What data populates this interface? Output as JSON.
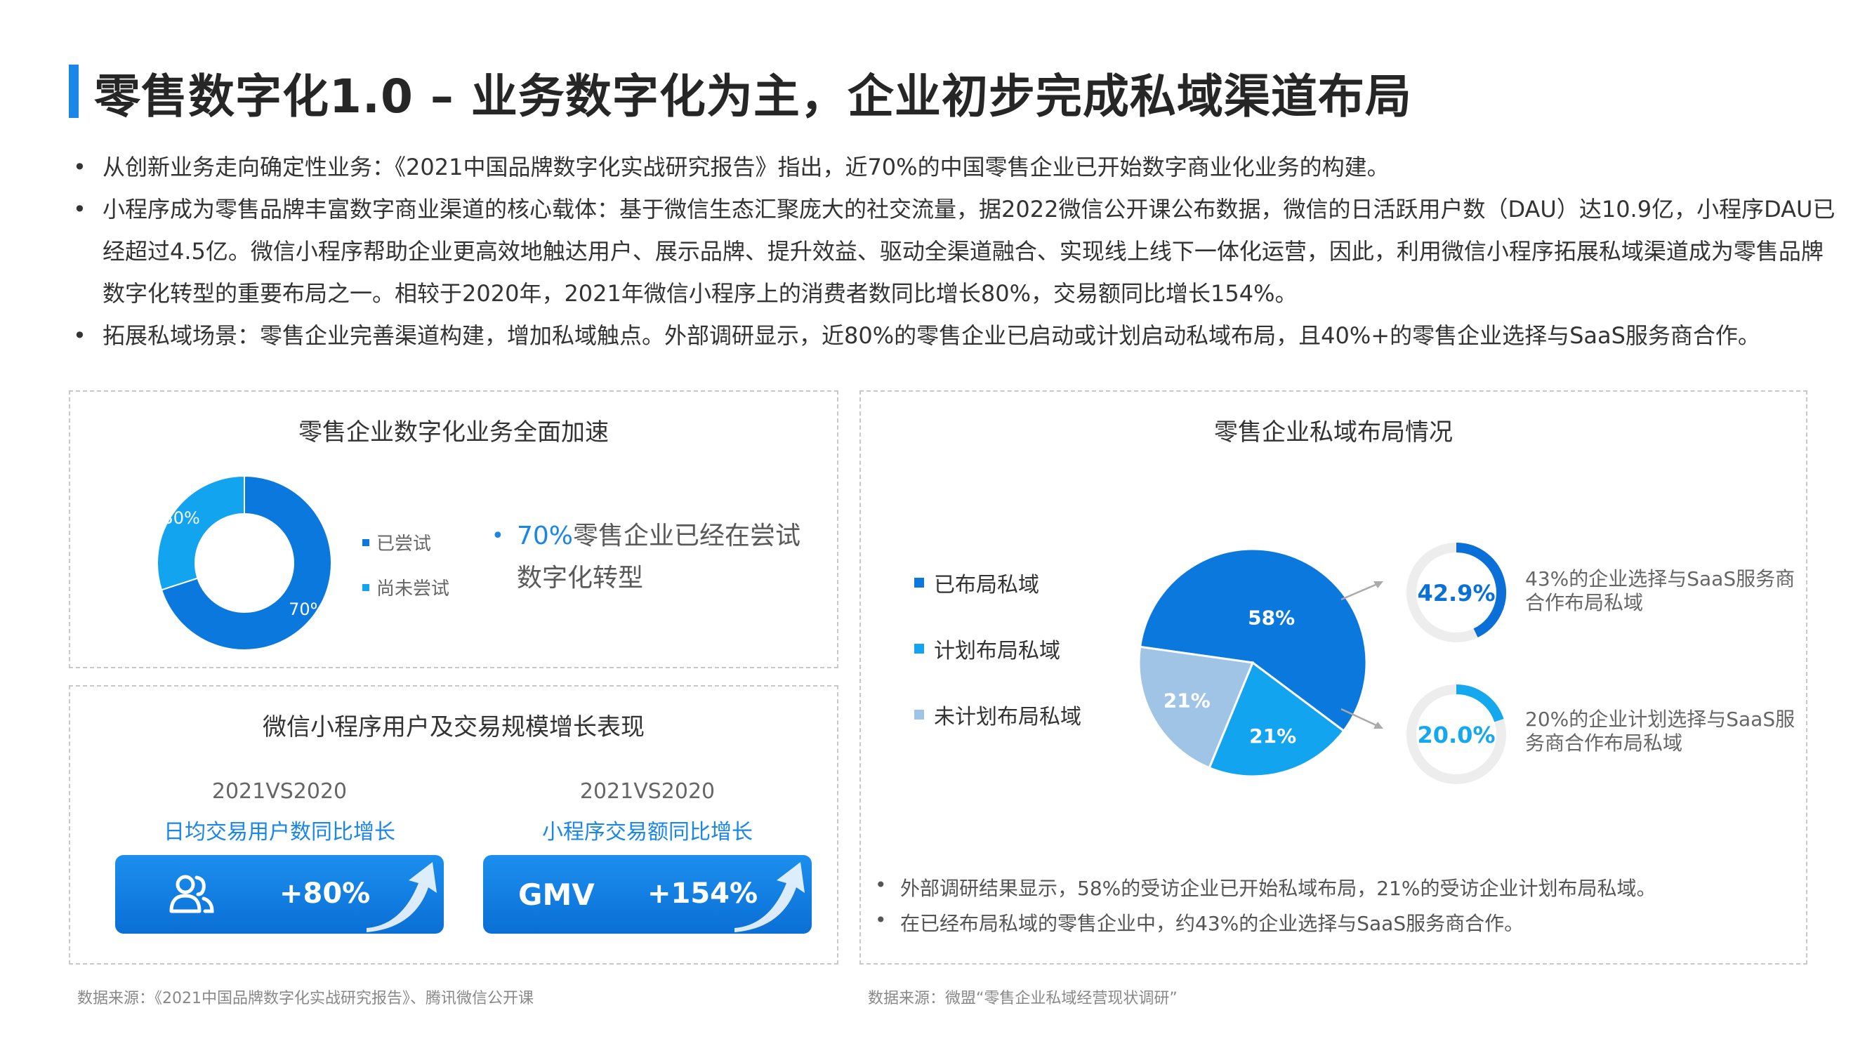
{
  "header": {
    "title": "零售数字化1.0 – 业务数字化为主，企业初步完成私域渠道布局"
  },
  "bullets": [
    "从创新业务走向确定性业务：《2021中国品牌数字化实战研究报告》指出，近70%的中国零售企业已开始数字商业化业务的构建。",
    "小程序成为零售品牌丰富数字商业渠道的核心载体：基于微信生态汇聚庞大的社交流量，据2022微信公开课公布数据，微信的日活跃用户数（DAU）达10.9亿，小程序DAU已经超过4.5亿。微信小程序帮助企业更高效地触达用户、展示品牌、提升效益、驱动全渠道融合、实现线上线下一体化运营，因此，利用微信小程序拓展私域渠道成为零售品牌数字化转型的重要布局之一。相较于2020年，2021年微信小程序上的消费者数同比增长80%，交易额同比增长154%。",
    "拓展私域场景：零售企业完善渠道构建，增加私域触点。外部调研显示，近80%的零售企业已启动或计划启动私域布局，且40%+的零售企业选择与SaaS服务商合作。"
  ],
  "panel_digital": {
    "title": "零售企业数字化业务全面加速",
    "highlight_number": "70%",
    "highlight_text": "零售企业已经在尝试数字化转型"
  },
  "panel_wechat": {
    "title": "微信小程序用户及交易规模增长表现",
    "left": {
      "period": "2021VS2020",
      "label": "日均交易用户数同比增长",
      "value": "+80%"
    },
    "right": {
      "period": "2021VS2020",
      "label": "小程序交易额同比增长",
      "value": "+154%",
      "badge": "GMV"
    }
  },
  "panel_private": {
    "title": "零售企业私域布局情况",
    "ring1": {
      "value_text": "42.9%",
      "value": 42.9,
      "desc": "43%的企业选择与SaaS服务商合作布局私域",
      "color": "#0a6fd6"
    },
    "ring2": {
      "value_text": "20.0%",
      "value": 20.0,
      "desc": "20%的企业计划选择与SaaS服务商合作布局私域",
      "color": "#14a8ef"
    },
    "notes": [
      "外部调研结果显示，58%的受访企业已开始私域布局，21%的受访企业计划布局私域。",
      "在已经布局私域的零售企业中，约43%的企业选择与SaaS服务商合作。"
    ]
  },
  "chart_data": [
    {
      "type": "pie",
      "subtype": "donut",
      "labels": [
        "已尝试",
        "尚未尝试"
      ],
      "values": [
        70,
        30
      ],
      "value_labels": [
        "70%",
        "30%"
      ],
      "colors": [
        "#0a78dc",
        "#12a4ee"
      ],
      "title": "零售企业数字化业务全面加速",
      "legend": "right"
    },
    {
      "type": "pie",
      "labels": [
        "已布局私域",
        "计划布局私域",
        "未计划布局私域"
      ],
      "values": [
        58,
        21,
        21
      ],
      "value_labels": [
        "58%",
        "21%",
        "21%"
      ],
      "colors": [
        "#0a78dc",
        "#12a4ee",
        "#a0c4e6"
      ],
      "title": "零售企业私域布局情况",
      "legend": "left"
    }
  ],
  "sources": {
    "left": "数据来源：《2021中国品牌数字化实战研究报告》、腾讯微信公开课",
    "right": "数据来源：微盟“零售企业私域经营现状调研”"
  }
}
